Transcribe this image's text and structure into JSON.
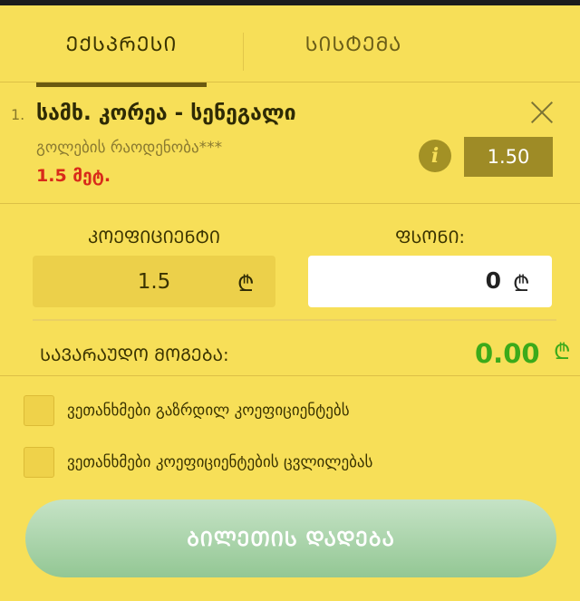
{
  "tabs": [
    {
      "label": "ᲔᲥᲡᲞᲠᲔᲡᲘ",
      "active": true
    },
    {
      "label": "ᲡᲘᲡᲢᲔᲛᲐ",
      "active": false
    }
  ],
  "bet": {
    "number": "1.",
    "match": "სამხ. კორეა - სენეგალი",
    "market": "გოლების რაოდენობა***",
    "selection": "1.5 მეტ.",
    "odds": "1.50"
  },
  "labels": {
    "coefficient": "ᲙᲝᲔᲤᲘᲪᲘᲔᲜᲢᲘ",
    "stake": "ᲤᲡᲝᲜᲘ:",
    "potential_win": "ᲡᲐᲕᲐᲠᲐᲣᲓᲝ ᲛᲝᲒᲔᲑᲐ:"
  },
  "coefficient_value": "1.5",
  "stake_value": "0",
  "potential_win_value": "0.00",
  "currency_symbol": "₾",
  "checkboxes": [
    {
      "label": "ვეთანხმები გაზრდილ კოეფიციენტებს",
      "checked": false
    },
    {
      "label": "ვეთანხმები კოეფიციენტების ცვლილებას",
      "checked": false
    }
  ],
  "submit_label": "ᲑᲘᲚᲔᲗᲘᲡ ᲓᲐᲓᲔᲑᲐ",
  "icons": {
    "close": "close-icon",
    "info": "info-icon"
  },
  "colors": {
    "background": "#f7df58",
    "selection": "#d82a1a",
    "win": "#3caa1a",
    "odds_badge": "#9e8b26"
  }
}
